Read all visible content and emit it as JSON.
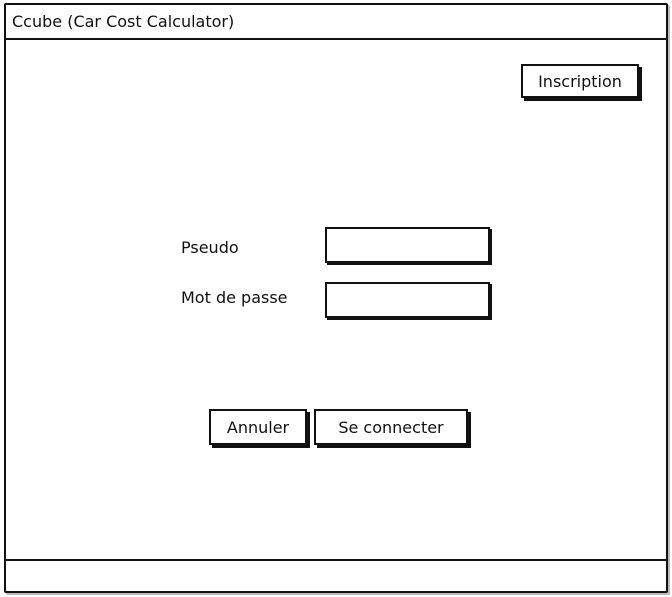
{
  "window": {
    "title": "Ccube (Car Cost Calculator)"
  },
  "header": {
    "register_label": "Inscription"
  },
  "form": {
    "username_label": "Pseudo",
    "username_value": "",
    "password_label": "Mot de passe",
    "password_value": ""
  },
  "actions": {
    "cancel_label": "Annuler",
    "connect_label": "Se connecter"
  },
  "statusbar": {
    "text": ""
  }
}
